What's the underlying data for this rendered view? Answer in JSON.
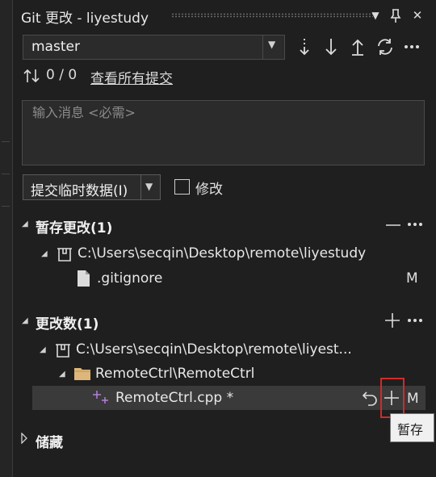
{
  "window": {
    "title": "Git 更改 - liyestudy",
    "buttons": {
      "dropdown": "▼",
      "pin": "📌",
      "close": "✕"
    }
  },
  "branch": {
    "selected": "master"
  },
  "toolbar": {
    "fetch_icon": "fetch-icon",
    "pull_icon": "pull-icon",
    "push_icon": "push-icon",
    "sync_icon": "sync-icon",
    "more_icon": "more-icon"
  },
  "sync_status": {
    "counts": "0 / 0",
    "view_all_link": "查看所有提交"
  },
  "message": {
    "placeholder": "输入消息 <必需>",
    "value": ""
  },
  "commit": {
    "button_label": "提交临时数据(I)",
    "amend_label": "修改",
    "amend_checked": false
  },
  "staged": {
    "title": "暂存更改(1)",
    "repo_path": "C:\\Users\\secqin\\Desktop\\remote\\liyestudy",
    "files": [
      {
        "name": ".gitignore",
        "status": "M"
      }
    ]
  },
  "changes": {
    "title": "更改数(1)",
    "repo_path": "C:\\Users\\secqin\\Desktop\\remote\\liyest...",
    "folder": "RemoteCtrl\\RemoteCtrl",
    "files": [
      {
        "name": "RemoteCtrl.cpp *",
        "status": "M"
      }
    ]
  },
  "stash": {
    "title": "储藏"
  },
  "tooltip": {
    "text": "暂存"
  },
  "colors": {
    "background": "#1f1f1f",
    "panel": "#2b2b2b",
    "highlight": "#d12a2a",
    "tooltip_bg": "#f0f0f0",
    "folder": "#dcb67a"
  }
}
